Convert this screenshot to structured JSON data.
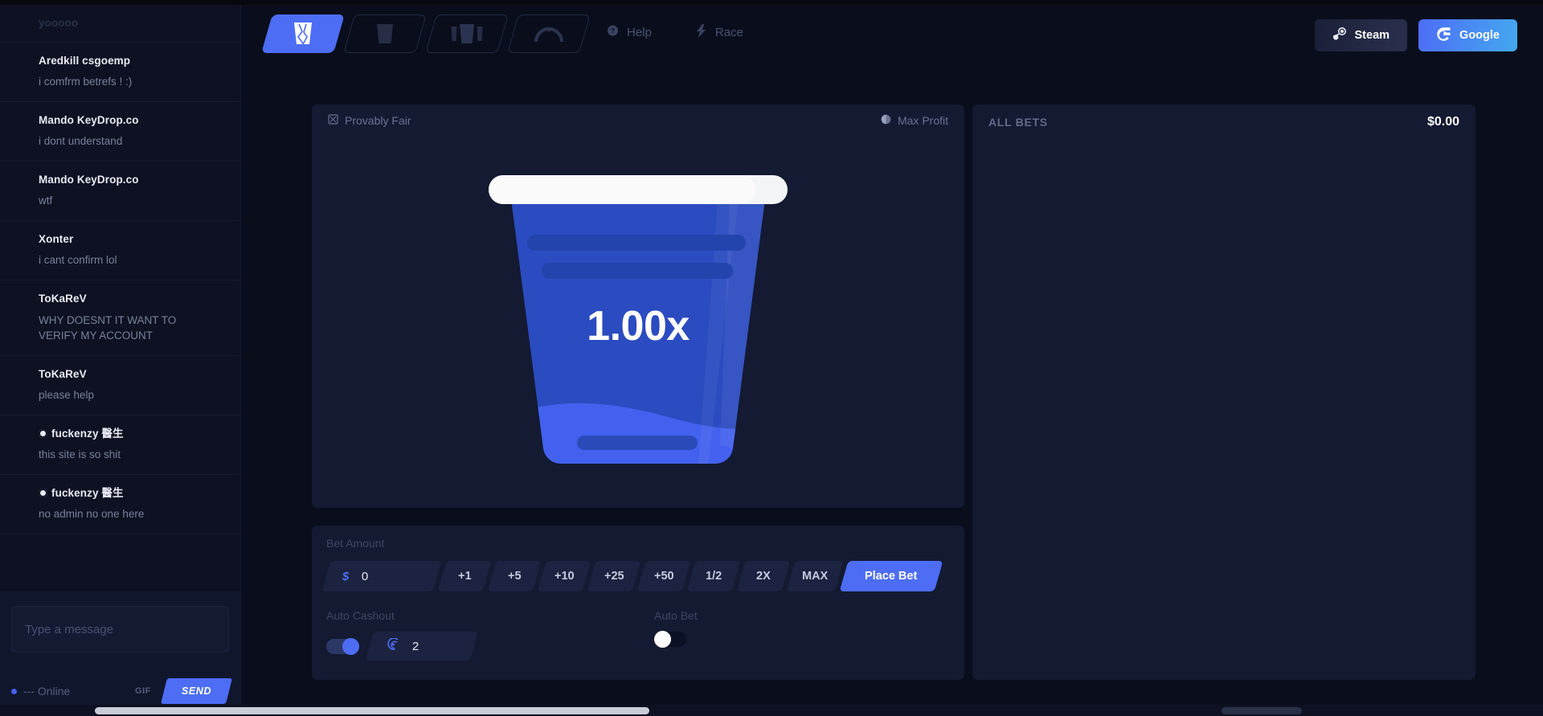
{
  "app": {
    "bg_color": "#0a0e1c",
    "accent": "#4d6df5",
    "panel_color": "#131a31"
  },
  "nav": {
    "tabs": [
      {
        "name": "crash-cup-tab",
        "icon": "cup-crash-icon",
        "active": true
      },
      {
        "name": "plinko-tab",
        "icon": "plain-cup-icon",
        "active": false
      },
      {
        "name": "cases-tab",
        "icon": "three-cups-icon",
        "active": false
      },
      {
        "name": "roulette-tab",
        "icon": "arc-gauge-icon",
        "active": false
      }
    ],
    "links": [
      {
        "label": "Help",
        "icon": "question-circle-icon"
      },
      {
        "label": "Race",
        "icon": "lightning-bolt-icon"
      }
    ],
    "auth": [
      {
        "label": "Steam",
        "icon": "steam-icon"
      },
      {
        "label": "Google",
        "icon": "google-g-icon"
      }
    ]
  },
  "chat": {
    "messages": [
      {
        "user": "yooooo",
        "text": "",
        "faded": true,
        "verified": false
      },
      {
        "user": "Aredkill csgoemp",
        "text": "i comfrm betrefs ! :)",
        "faded": false,
        "verified": false
      },
      {
        "user": "Mando KeyDrop.co",
        "text": "i dont understand",
        "faded": false,
        "verified": false
      },
      {
        "user": "Mando KeyDrop.co",
        "text": "wtf",
        "faded": false,
        "verified": false
      },
      {
        "user": "Xonter",
        "text": "i cant confirm lol",
        "faded": false,
        "verified": false
      },
      {
        "user": "ToKaReV",
        "text": "WHY DOESNT IT WANT TO VERIFY MY ACCOUNT",
        "faded": false,
        "verified": false
      },
      {
        "user": "ToKaReV",
        "text": "please help",
        "faded": false,
        "verified": false
      },
      {
        "user": "fuckenzy 醫生",
        "text": "this site is so shit",
        "faded": false,
        "verified": true
      },
      {
        "user": "fuckenzy 醫生",
        "text": "no admin no one here",
        "faded": false,
        "verified": true
      }
    ],
    "input_placeholder": "Type a message",
    "input_value": "",
    "online_label": "--- Online",
    "gif_label": "GIF",
    "send_label": "SEND"
  },
  "game": {
    "provably_fair_label": "Provably Fair",
    "max_profit_label": "Max Profit",
    "multiplier": "1.00x"
  },
  "bet": {
    "amount_label": "Bet Amount",
    "currency_symbol": "$",
    "amount_value": "0",
    "quick_buttons": [
      "+1",
      "+5",
      "+10",
      "+25",
      "+50",
      "1/2",
      "2X",
      "MAX"
    ],
    "place_bet_label": "Place Bet",
    "auto_cashout_label": "Auto Cashout",
    "auto_cashout_enabled": true,
    "auto_cashout_value": "2",
    "auto_bet_label": "Auto Bet",
    "auto_bet_enabled": false
  },
  "all_bets": {
    "title": "ALL BETS",
    "total": "$0.00",
    "rows": []
  }
}
